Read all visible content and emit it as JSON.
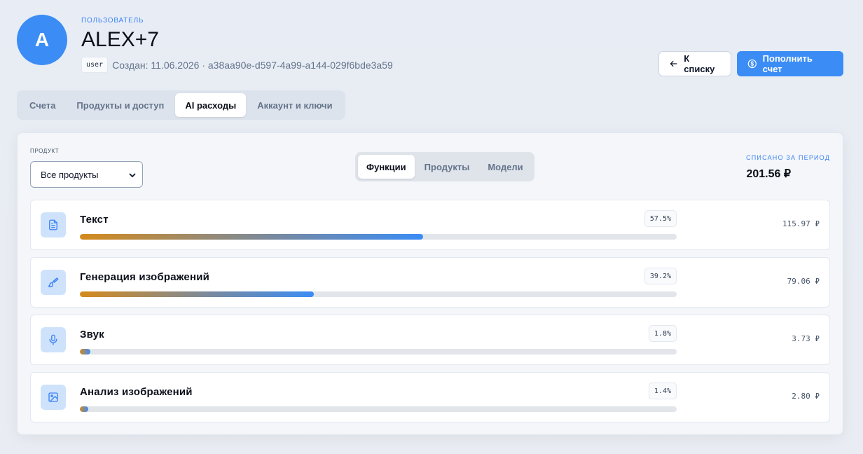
{
  "user": {
    "avatar_letter": "A",
    "kicker": "ПОЛЬЗОВАТЕЛЬ",
    "name": "ALEX+7",
    "role": "user",
    "created": "Создан: 11.06.2026 · a38aa90e-d597-4a99-a144-029f6bde3a59"
  },
  "actions": {
    "back_label": "К списку",
    "topup_label": "Пополнить счет"
  },
  "tabs": [
    {
      "label": "Счета",
      "active": false
    },
    {
      "label": "Продукты и доступ",
      "active": false
    },
    {
      "label": "AI расходы",
      "active": true
    },
    {
      "label": "Аккаунт и ключи",
      "active": false
    }
  ],
  "filter": {
    "label": "ПРОДУКТ",
    "selected": "Все продукты"
  },
  "segments": [
    {
      "label": "Функции",
      "active": true
    },
    {
      "label": "Продукты",
      "active": false
    },
    {
      "label": "Модели",
      "active": false
    }
  ],
  "total": {
    "label": "СПИСАНО ЗА ПЕРИОД",
    "value": "201.56 ₽"
  },
  "items": [
    {
      "title": "Текст",
      "percent_label": "57.5%",
      "share": 0.575,
      "amount": "115.97 ₽",
      "icon": "document-icon"
    },
    {
      "title": "Генерация изображений",
      "percent_label": "39.2%",
      "share": 0.392,
      "amount": "79.06 ₽",
      "icon": "brush-icon"
    },
    {
      "title": "Звук",
      "percent_label": "1.8%",
      "share": 0.018,
      "amount": "3.73 ₽",
      "icon": "microphone-icon"
    },
    {
      "title": "Анализ изображений",
      "percent_label": "1.4%",
      "share": 0.014,
      "amount": "2.80 ₽",
      "icon": "image-icon"
    }
  ],
  "colors": {
    "accent": "#3b8cf5",
    "bar_start": "#d48a1c",
    "bar_end": "#3b8cf5"
  }
}
